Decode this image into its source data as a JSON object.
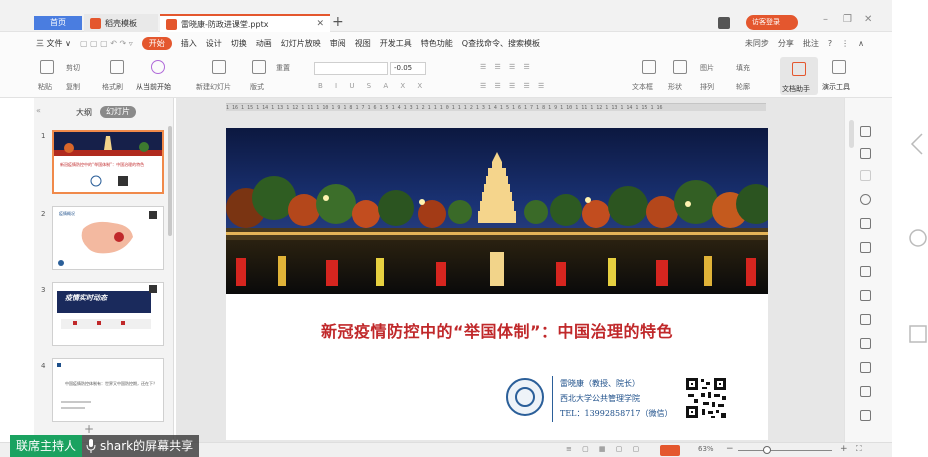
{
  "tabbar": {
    "home_label": "首页",
    "docer_label": "稻壳模板",
    "file_tab_label": "雷晓康-防政进课堂.pptx",
    "visitor_label": "访客登录"
  },
  "menu": {
    "items": [
      "三 文件 ∨",
      "开始",
      "插入",
      "设计",
      "切换",
      "动画",
      "幻灯片放映",
      "审阅",
      "视图",
      "开发工具",
      "特色功能"
    ],
    "search_label": "Q查找命令、搜索模板",
    "right_items": [
      "未同步",
      "分享",
      "批注"
    ]
  },
  "toolbar": {
    "paste_label": "粘贴",
    "cut_label": "剪切",
    "copy_label": "复制",
    "format_painter_label": "格式刷",
    "from_current_label": "从当前开始",
    "new_slide_label": "新建幻灯片",
    "layout_label": "版式",
    "reset_label": "重置",
    "font_size_value": "-0.05",
    "text_box_label": "文本框",
    "shape_label": "形状",
    "arrange_label": "排列",
    "picture_label": "图片",
    "fill_label": "填充",
    "outline_label": "轮廓",
    "doc_helper_label": "文档助手",
    "present_tools_label": "演示工具"
  },
  "left_panel": {
    "outline_tab": "大纲",
    "slides_tab": "幻灯片",
    "slide_numbers": [
      "1",
      "2",
      "3",
      "4"
    ],
    "thumb1_title": "新冠疫情防控中的“举国体制”：中国治理的特色",
    "thumb2_title": "疫情概况",
    "thumb3_title": "疫情实时动态",
    "thumb4_text": "中国疫情防控体制有：世界又中国防控期，还在下？"
  },
  "ruler": {
    "text": "1 16 1 15 1 14 1 13 1 12 1 11 1 10 1 9 1 8 1 7 1 6 1 5 1 4 1 3 1 2 1 1 1 0 1 1 1 2 1 3 1 4 1 5 1 6 1 7 1 8 1 9 1 10 1 11 1 12 1 13 1 14 1 15 1 16"
  },
  "slide": {
    "title": "新冠疫情防控中的“举国体制”：中国治理的特色",
    "author_name": "雷晓康（教授、院长）",
    "author_org": "西北大学公共管理学院",
    "author_tel": "TEL：13992858717（微信）"
  },
  "statusbar": {
    "zoom_label": "63%",
    "zoom_minus": "−",
    "zoom_plus": "+"
  },
  "share": {
    "host_label": "联席主持人",
    "share_label": "shark的屏幕共享"
  },
  "colors": {
    "accent": "#e4572e",
    "title_red": "#c0282a",
    "author_blue": "#1d4f8a",
    "host_green": "#1aa260",
    "home_tab_blue": "#4a7de0"
  }
}
